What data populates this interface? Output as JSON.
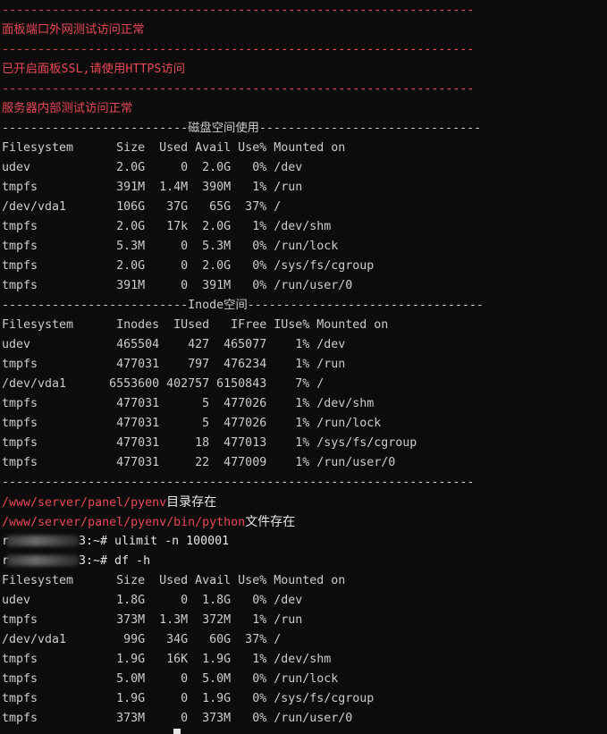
{
  "terminal": {
    "colors": {
      "background": "#0c0c0c",
      "text": "#cccccc",
      "red": "#e74856"
    },
    "lines": [
      {
        "kind": "red",
        "text": "------------------------------------------------------------------"
      },
      {
        "kind": "red",
        "text": "面板端口外网测试访问正常"
      },
      {
        "kind": "red",
        "text": "------------------------------------------------------------------"
      },
      {
        "kind": "red",
        "text": "已开启面板SSL,请使用HTTPS访问"
      },
      {
        "kind": "red",
        "text": "------------------------------------------------------------------"
      },
      {
        "kind": "red",
        "text": "服务器内部测试访问正常"
      },
      {
        "kind": "plain",
        "text": "--------------------------磁盘空间使用-------------------------------"
      },
      {
        "kind": "plain",
        "text": "Filesystem      Size  Used Avail Use% Mounted on"
      },
      {
        "kind": "plain",
        "text": "udev            2.0G     0  2.0G   0% /dev"
      },
      {
        "kind": "plain",
        "text": "tmpfs           391M  1.4M  390M   1% /run"
      },
      {
        "kind": "plain",
        "text": "/dev/vda1       106G   37G   65G  37% /"
      },
      {
        "kind": "plain",
        "text": "tmpfs           2.0G   17k  2.0G   1% /dev/shm"
      },
      {
        "kind": "plain",
        "text": "tmpfs           5.3M     0  5.3M   0% /run/lock"
      },
      {
        "kind": "plain",
        "text": "tmpfs           2.0G     0  2.0G   0% /sys/fs/cgroup"
      },
      {
        "kind": "plain",
        "text": "tmpfs           391M     0  391M   0% /run/user/0"
      },
      {
        "kind": "plain",
        "text": "--------------------------Inode空间---------------------------------"
      },
      {
        "kind": "plain",
        "text": "Filesystem      Inodes  IUsed   IFree IUse% Mounted on"
      },
      {
        "kind": "plain",
        "text": "udev            465504    427  465077    1% /dev"
      },
      {
        "kind": "plain",
        "text": "tmpfs           477031    797  476234    1% /run"
      },
      {
        "kind": "plain",
        "text": "/dev/vda1      6553600 402757 6150843    7% /"
      },
      {
        "kind": "plain",
        "text": "tmpfs           477031      5  477026    1% /dev/shm"
      },
      {
        "kind": "plain",
        "text": "tmpfs           477031      5  477026    1% /run/lock"
      },
      {
        "kind": "plain",
        "text": "tmpfs           477031     18  477013    1% /sys/fs/cgroup"
      },
      {
        "kind": "plain",
        "text": "tmpfs           477031     22  477009    1% /run/user/0"
      },
      {
        "kind": "plain",
        "text": "------------------------------------------------------------------"
      },
      {
        "kind": "mixed",
        "red": "/www/server/panel/pyenv",
        "rest": "目录存在"
      },
      {
        "kind": "mixed",
        "red": "/www/server/panel/pyenv/bin/python",
        "rest": "文件存在"
      },
      {
        "kind": "prompt",
        "prefix": "r",
        "suffix": "3:~# ulimit -n 100001"
      },
      {
        "kind": "prompt",
        "prefix": "r",
        "suffix": "3:~# df -h"
      },
      {
        "kind": "plain",
        "text": "Filesystem      Size  Used Avail Use% Mounted on"
      },
      {
        "kind": "plain",
        "text": "udev            1.8G     0  1.8G   0% /dev"
      },
      {
        "kind": "plain",
        "text": "tmpfs           373M  1.3M  372M   1% /run"
      },
      {
        "kind": "plain",
        "text": "/dev/vda1        99G   34G   60G  37% /"
      },
      {
        "kind": "plain",
        "text": "tmpfs           1.9G   16K  1.9G   1% /dev/shm"
      },
      {
        "kind": "plain",
        "text": "tmpfs           5.0M     0  5.0M   0% /run/lock"
      },
      {
        "kind": "plain",
        "text": "tmpfs           1.9G     0  1.9G   0% /sys/fs/cgroup"
      },
      {
        "kind": "plain",
        "text": "tmpfs           373M     0  373M   0% /run/user/0"
      }
    ]
  }
}
